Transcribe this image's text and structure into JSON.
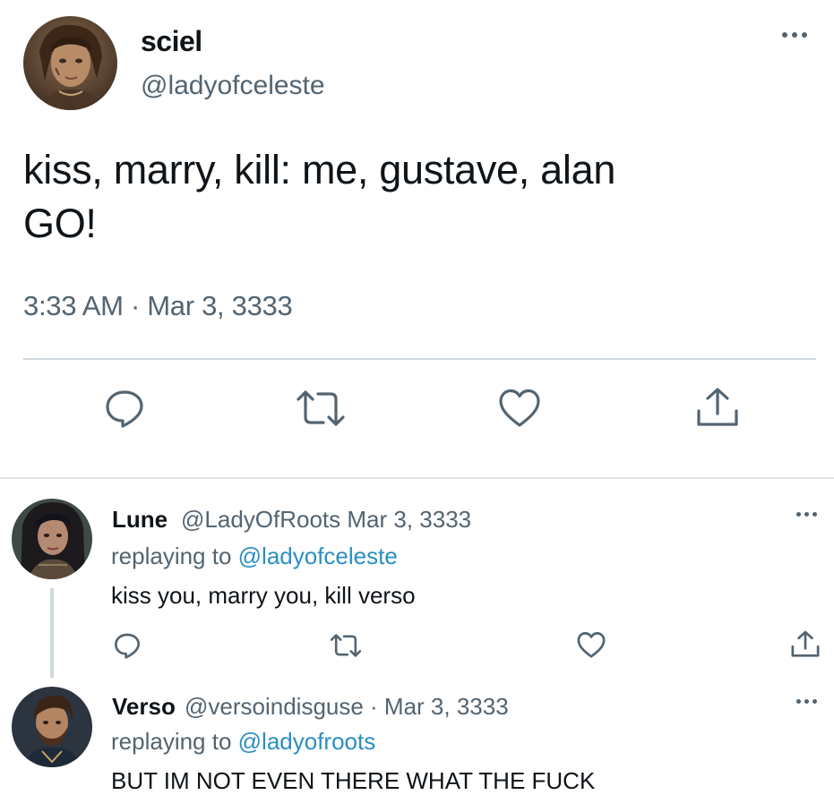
{
  "tweet": {
    "display_name": "sciel",
    "handle": "@ladyofceleste",
    "text_line1": "kiss, marry, kill: me, gustave, alan",
    "text_line2": "GO!",
    "timestamp": "3:33 AM · Mar 3, 3333",
    "actions": [
      "reply-icon",
      "retweet-icon",
      "like-icon",
      "share-icon"
    ]
  },
  "replies": [
    {
      "display_name": "Lune",
      "handle_date": "@LadyOfRoots Mar 3, 3333",
      "replying_prefix": "replaying to",
      "replying_to": "@ladyofceleste",
      "text": "kiss you, marry you, kill verso"
    },
    {
      "display_name": "Verso",
      "handle_date": "@versoindisguse · Mar 3, 3333",
      "replying_prefix": "replaying to",
      "replying_to": "@ladyofroots",
      "text": "BUT IM NOT EVEN THERE WHAT THE FUCK"
    }
  ],
  "colors": {
    "text": "#0f1419",
    "secondary": "#536471",
    "link": "#2a8fc2",
    "divider": "#cfd9de"
  }
}
